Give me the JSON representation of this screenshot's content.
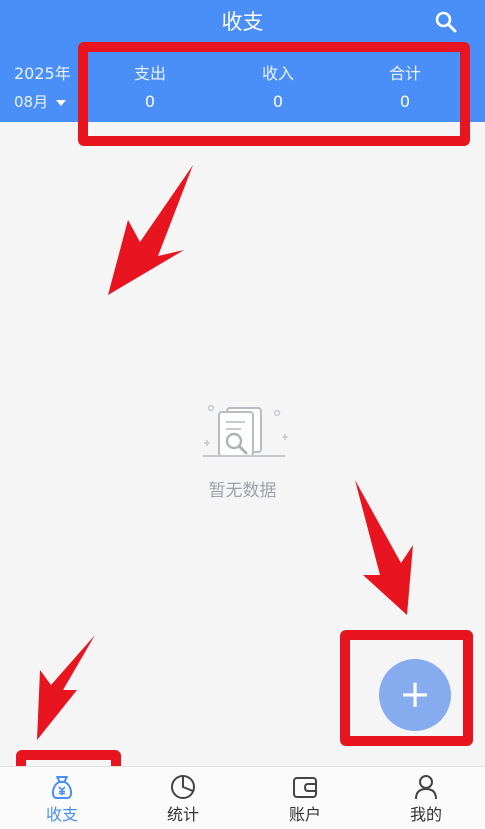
{
  "header": {
    "title": "收支",
    "year": "2025年",
    "month": "08月",
    "stats": [
      {
        "label": "支出",
        "value": "0"
      },
      {
        "label": "收入",
        "value": "0"
      },
      {
        "label": "合计",
        "value": "0"
      }
    ]
  },
  "empty_state": {
    "text": "暂无数据"
  },
  "fab": {
    "label": "+"
  },
  "tabs": [
    {
      "label": "收支",
      "icon": "money-bag-icon",
      "active": true
    },
    {
      "label": "统计",
      "icon": "pie-chart-icon",
      "active": false
    },
    {
      "label": "账户",
      "icon": "wallet-icon",
      "active": false
    },
    {
      "label": "我的",
      "icon": "person-icon",
      "active": false
    }
  ],
  "colors": {
    "primary": "#4a8ff7",
    "fab": "#86acef",
    "annotation": "#e8141f",
    "background": "#f5f5f5"
  }
}
